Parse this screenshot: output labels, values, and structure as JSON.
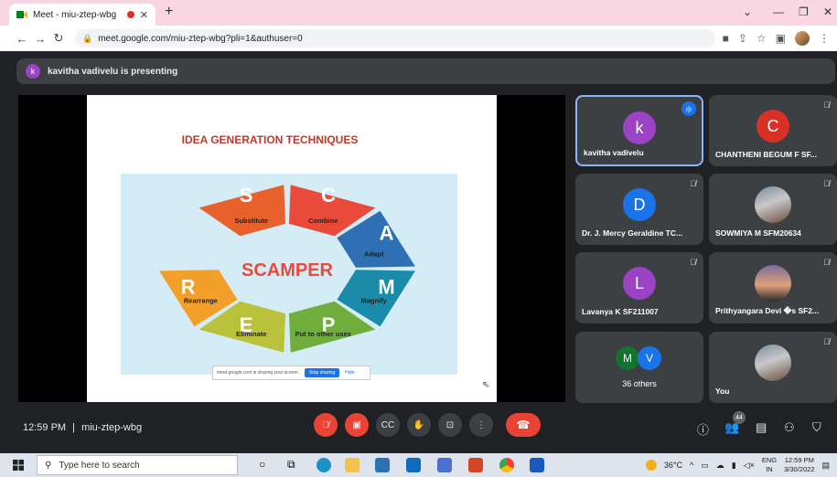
{
  "browser": {
    "tab_title": "Meet - miu-ztep-wbg",
    "url": "meet.google.com/miu-ztep-wbg?pli=1&authuser=0"
  },
  "meet": {
    "presenting_initial": "k",
    "presenting_text": "kavitha vadivelu is presenting",
    "slide": {
      "title": "IDEA GENERATION TECHNIQUES",
      "center": "SCAMPER",
      "segments": [
        {
          "letter": "S",
          "word": "Substitute",
          "color": "#e8612c"
        },
        {
          "letter": "C",
          "word": "Combine",
          "color": "#e84b3a"
        },
        {
          "letter": "A",
          "word": "Adapt",
          "color": "#2f6fb3"
        },
        {
          "letter": "M",
          "word": "Magnify",
          "color": "#1a8ba8"
        },
        {
          "letter": "P",
          "word": "Put to other uses",
          "color": "#6fae3c"
        },
        {
          "letter": "E",
          "word": "Eliminate",
          "color": "#b9c23a"
        },
        {
          "letter": "R",
          "word": "Rearrange",
          "color": "#f3a02b"
        }
      ],
      "share_text": "meet.google.com is sharing your screen.",
      "stop_label": "Stop sharing",
      "hide_label": "Hide"
    },
    "participants": [
      {
        "name": "kavitha vadivelu",
        "initial": "k",
        "color": "#9c42c4"
      },
      {
        "name": "CHANTHENI BEGUM F SF...",
        "initial": "C",
        "color": "#d93025"
      },
      {
        "name": "Dr. J. Mercy Geraldine TC...",
        "initial": "D",
        "color": "#1a73e8"
      },
      {
        "name": "SOWMIYA M SFM20634",
        "initial": ""
      },
      {
        "name": "Lavanya K SF211007",
        "initial": "L",
        "color": "#9c42c4"
      },
      {
        "name": "Prithyangara Devi �s SF2...",
        "initial": ""
      },
      {
        "name": "You",
        "initial": ""
      }
    ],
    "others": {
      "initials": [
        "M",
        "V"
      ],
      "label": "36 others"
    },
    "time": "12:59 PM",
    "separator": "|",
    "meeting_code": "miu-ztep-wbg",
    "people_count": "44"
  },
  "taskbar": {
    "search_placeholder": "Type here to search",
    "temperature": "36°C",
    "lang": "ENG",
    "region": "IN",
    "clock_time": "12:59 PM",
    "clock_date": "3/30/2022"
  }
}
